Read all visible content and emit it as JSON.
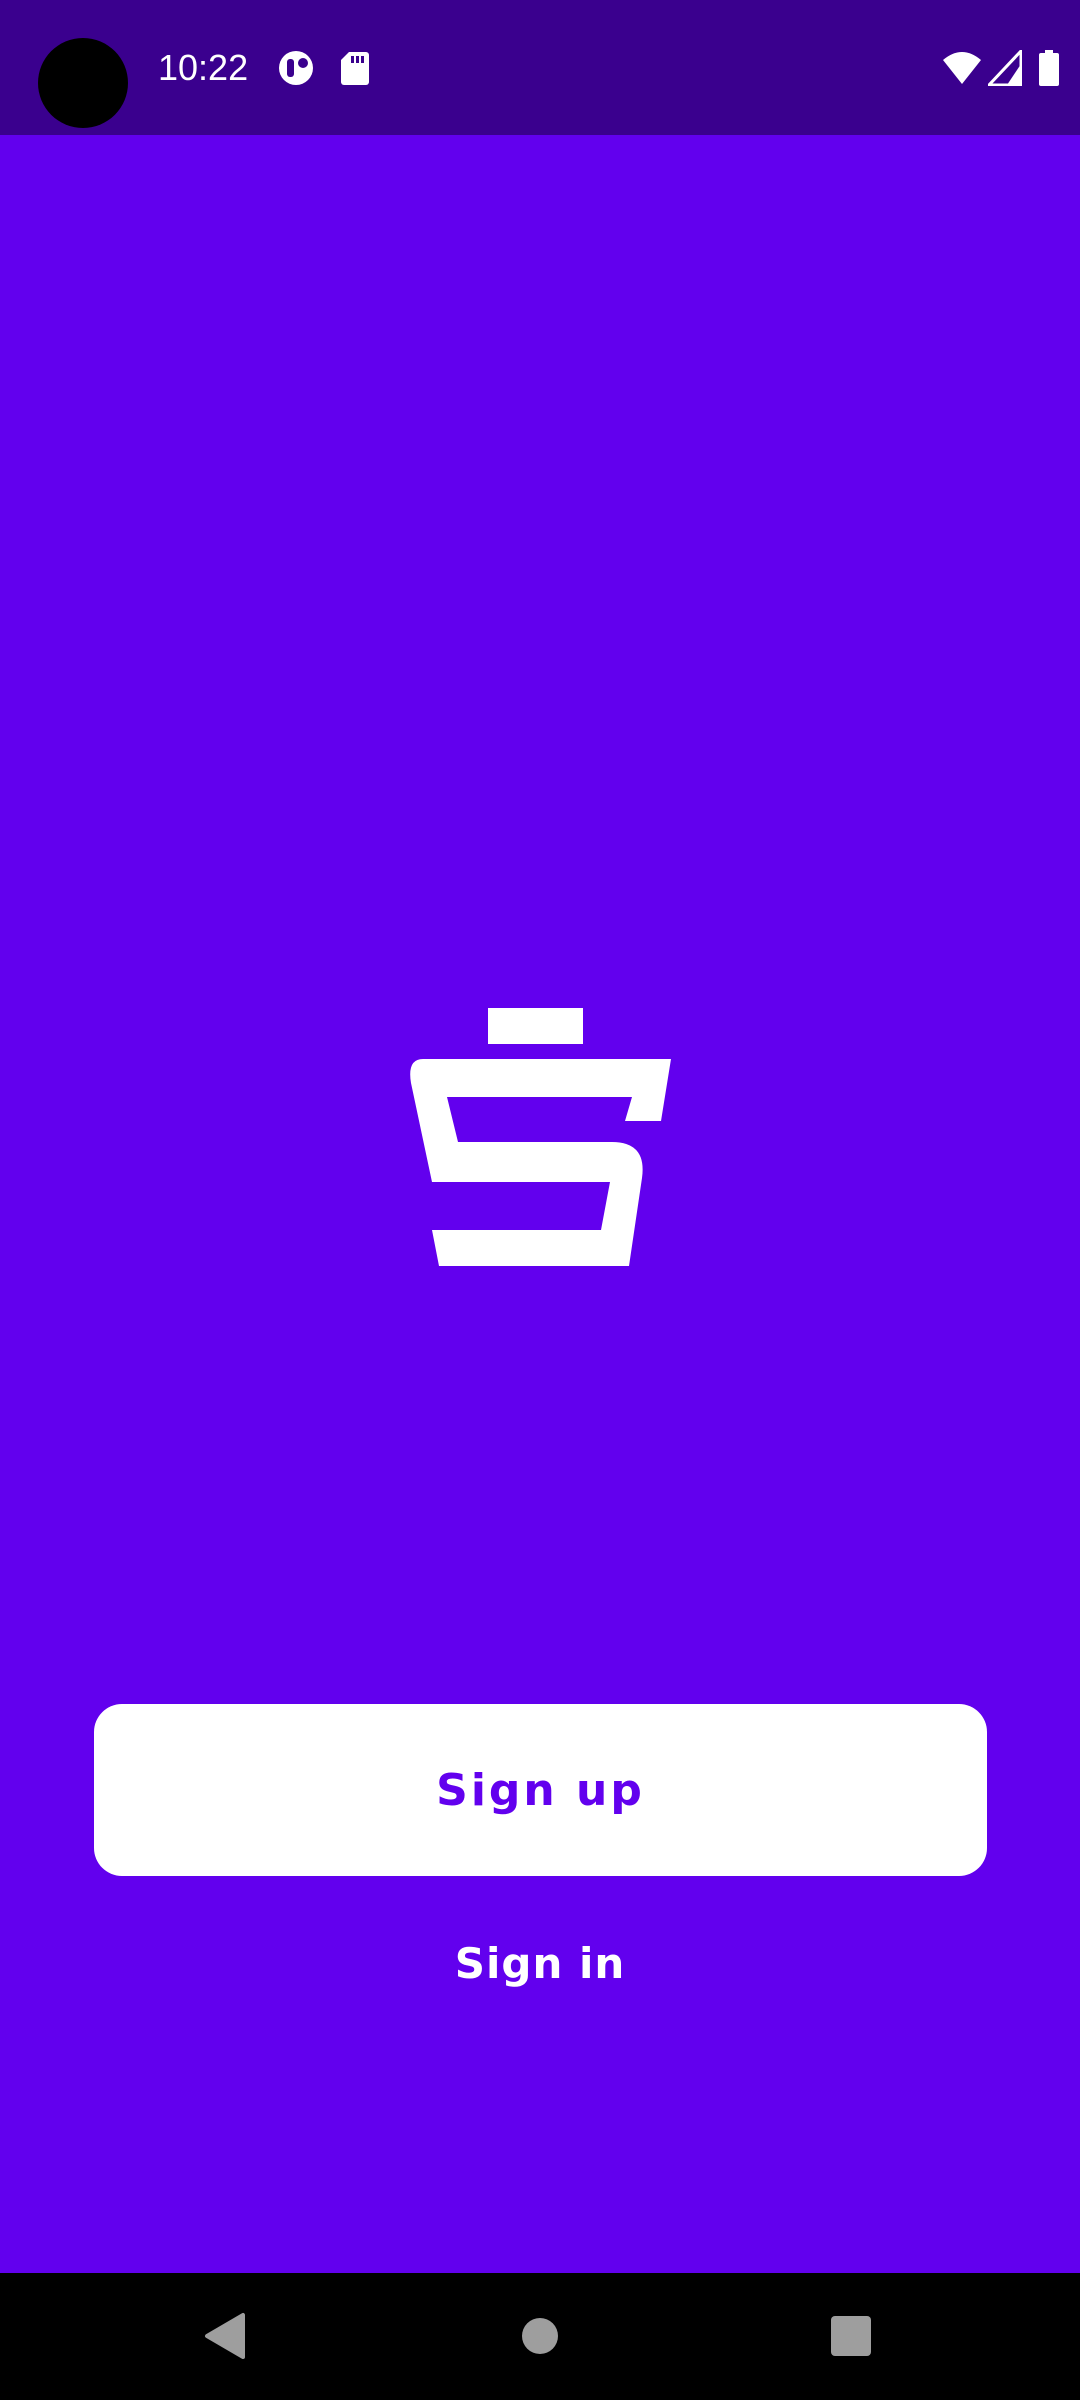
{
  "status_bar": {
    "time": "10:22",
    "icons": [
      "notification-app-icon",
      "sd-card-icon",
      "wifi-icon",
      "cell-signal-icon",
      "battery-icon"
    ]
  },
  "brand": {
    "logo_icon": "s-logo-icon",
    "background_color": "#6200ee",
    "status_bar_color": "#3a008e"
  },
  "actions": {
    "sign_up_label": "Sign up",
    "sign_in_label": "Sign in"
  },
  "nav_bar": {
    "icons": [
      "back-icon",
      "home-icon",
      "recents-icon"
    ]
  }
}
